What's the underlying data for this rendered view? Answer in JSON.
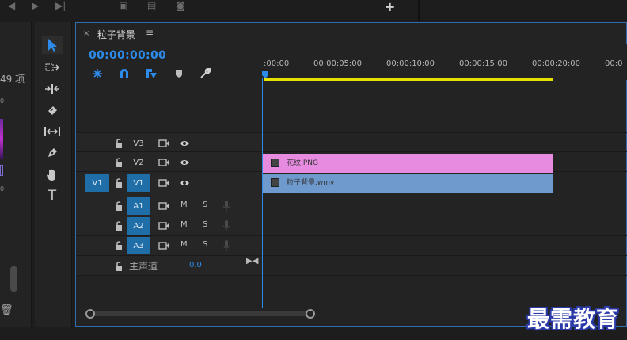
{
  "project_panel": {
    "item_count": "49 项",
    "marker_a": "0",
    "marker_b": "0"
  },
  "tools": [
    {
      "name": "selection-tool",
      "icon": "arrow-icon",
      "active": true
    },
    {
      "name": "track-select-forward-tool",
      "icon": "track-select-icon"
    },
    {
      "name": "ripple-edit-tool",
      "icon": "ripple-edit-icon"
    },
    {
      "name": "razor-tool",
      "icon": "razor-icon"
    },
    {
      "name": "slip-tool",
      "icon": "slip-icon"
    },
    {
      "name": "pen-tool",
      "icon": "pen-icon"
    },
    {
      "name": "hand-tool",
      "icon": "hand-icon"
    },
    {
      "name": "type-tool",
      "icon": "type-icon",
      "label": "T"
    }
  ],
  "timeline": {
    "tab_title": "粒子背景",
    "close_glyph": "×",
    "menu_glyph": "≡",
    "timecode": "00:00:00:00",
    "ruler_ticks": [
      ":00:00",
      "00:00:05:00",
      "00:00:10:00",
      "00:00:15:00",
      "00:00:20:00",
      "00:0"
    ],
    "tracks": {
      "v3": "V3",
      "v2": "V2",
      "v1": "V1",
      "v1_source": "V1",
      "a1": "A1",
      "a2": "A2",
      "a3": "A3",
      "mute": "M",
      "solo": "S"
    },
    "master": {
      "label": "主声道",
      "value": "0.0"
    },
    "clips": [
      {
        "track": "V2",
        "name": "花纹.PNG",
        "color": "#e68be0"
      },
      {
        "track": "V1",
        "name": "粒子背景.wmv",
        "color": "#6f9acd"
      }
    ]
  },
  "watermark": "最需教育",
  "colors": {
    "accent": "#2d8ceb",
    "workarea": "#e8e000",
    "target": "#1f6ea8"
  }
}
